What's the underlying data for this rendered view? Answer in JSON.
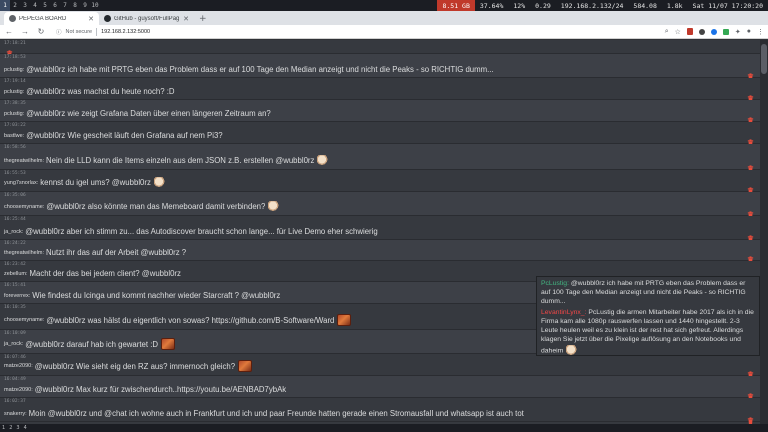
{
  "system_bar": {
    "workspaces": [
      "1",
      "2",
      "3",
      "4",
      "5",
      "6",
      "7",
      "8",
      "9",
      "10"
    ],
    "active_workspace": "1",
    "items": [
      {
        "label": "8.51 GB",
        "style": "red"
      },
      {
        "label": "37.64%",
        "style": ""
      },
      {
        "label": "12%",
        "style": ""
      },
      {
        "label": "0.29",
        "style": ""
      },
      {
        "label": "192.168.2.132/24",
        "style": ""
      },
      {
        "label": "584.08",
        "style": ""
      },
      {
        "label": "1.8k",
        "style": ""
      },
      {
        "label": "Sat 11/07 17:20:20",
        "style": ""
      }
    ]
  },
  "browser": {
    "tabs": [
      {
        "title": "PEPEGA BOARD",
        "active": true
      },
      {
        "title": "GitHub - guysoft/FullPag",
        "active": false
      }
    ],
    "newtab": "+",
    "url": "192.168.2.132:5000",
    "security_label": "Not secure",
    "nav": {
      "back": "←",
      "forward": "→",
      "reload": "↻"
    }
  },
  "messages": [
    {
      "time": "17:18:21",
      "user": "",
      "text": "",
      "emote": "",
      "trash": true
    },
    {
      "time": "17:18:53",
      "user": "pclustig:",
      "text": "@wubbl0rz ich habe mit PRTG eben das Problem dass er auf 100 Tage den Median anzeigt und nicht die Peaks - so RICHTIG dumm...",
      "emote": "",
      "trash": true
    },
    {
      "time": "17:19:14",
      "user": "pclustig:",
      "text": "@wubbl0rz was machst du heute noch? :D",
      "emote": "",
      "trash": true
    },
    {
      "time": "17:38:35",
      "user": "pclustig:",
      "text": "@wubbl0rz wie zeigt Grafana Daten über einen längeren Zeitraum an?",
      "emote": "",
      "trash": true
    },
    {
      "time": "17:03:22",
      "user": "bastlwe:",
      "text": "@wubbl0rz Wie gescheit läuft den Grafana auf nem Pi3?",
      "emote": "",
      "trash": true
    },
    {
      "time": "16:58:56",
      "user": "thegreatwilhelm:",
      "text": "Nein die LLD kann die Items einzeln aus dem JSON z.B. erstellen @wubbl0rz",
      "emote": "face",
      "trash": true
    },
    {
      "time": "16:55:53",
      "user": "yung7snorlax:",
      "text": "kennst du igel ums? @wubbl0rz",
      "emote": "face",
      "trash": true
    },
    {
      "time": "16:35:06",
      "user": "choosemyname:",
      "text": "@wubbl0rz also könnte man das Memeboard damit verbinden?",
      "emote": "face",
      "trash": true
    },
    {
      "time": "16:25:44",
      "user": "ja_rock:",
      "text": "@wubbl0rz aber ich stimm zu... das Autodiscover braucht schon lange... für Live Demo eher schwierig",
      "emote": "",
      "trash": true
    },
    {
      "time": "16:24:22",
      "user": "thegreatwilhelm:",
      "text": "Nutzt ihr das auf der Arbeit @wubbl0rz ?",
      "emote": "",
      "trash": true
    },
    {
      "time": "16:23:42",
      "user": "zebellum:",
      "text": "Macht der das bei jedem client? @wubbl0rz",
      "emote": "",
      "trash": true
    },
    {
      "time": "16:15:41",
      "user": "foreverrex:",
      "text": "Wie findest du Icinga und kommt nachher wieder Starcraft ? @wubbl0rz",
      "emote": "",
      "trash": false
    },
    {
      "time": "16:10:35",
      "user": "choosemyname:",
      "text": "@wubbl0rz was hälst du eigentlich von sowas? https://github.com/B-Software/Ward",
      "emote": "box",
      "trash": false
    },
    {
      "time": "16:10:09",
      "user": "ja_rock:",
      "text": "@wubbl0rz darauf hab ich gewartet :D",
      "emote": "box",
      "trash": false
    },
    {
      "time": "16:07:46",
      "user": "matze2090:",
      "text": "@wubbl0rz Wie sieht eig den RZ aus? immernoch gleich?",
      "emote": "box",
      "trash": true
    },
    {
      "time": "16:04:49",
      "user": "matze2090:",
      "text": "@wubbl0rz Max kurz für zwischendurch..https://youtu.be/AENBAD7ybAk",
      "emote": "",
      "trash": true
    },
    {
      "time": "16:02:37",
      "user": "snakerry:",
      "text": "Moin @wubbl0rz und @chat ich wohne auch in Frankfurt und ich und paar Freunde hatten gerade einen Stromausfall und whatsapp ist auch tot",
      "emote": "",
      "trash": true
    }
  ],
  "popup": {
    "messages": [
      {
        "user": "PcLustig:",
        "text": "@wubbl0rz ich habe mit PRTG eben das Problem dass er auf 100 Tage den Median anzeigt und nicht die Peaks - so RICHTIG dumm...",
        "user_color": "green",
        "emote": ""
      },
      {
        "user": "LevantinLynx_:",
        "text": "PcLustig die armen Mitarbeiter habe 2017 als ich in die Firma kam alle 1080p rauswerfen lassen und 1440 hingestellt. 2-3 Leute heulen weil es zu klein ist der rest hat sich gefreut. Allerdings klagen Sie jetzt über die Pixelige auflösung an den Notebooks und daheim",
        "user_color": "red",
        "emote": "face"
      }
    ]
  },
  "bottom_strip": {
    "items": [
      "1",
      "2",
      "3",
      "4"
    ]
  },
  "colors": {
    "accent": "#43b581",
    "danger": "#f04747",
    "background": "#36393f"
  }
}
